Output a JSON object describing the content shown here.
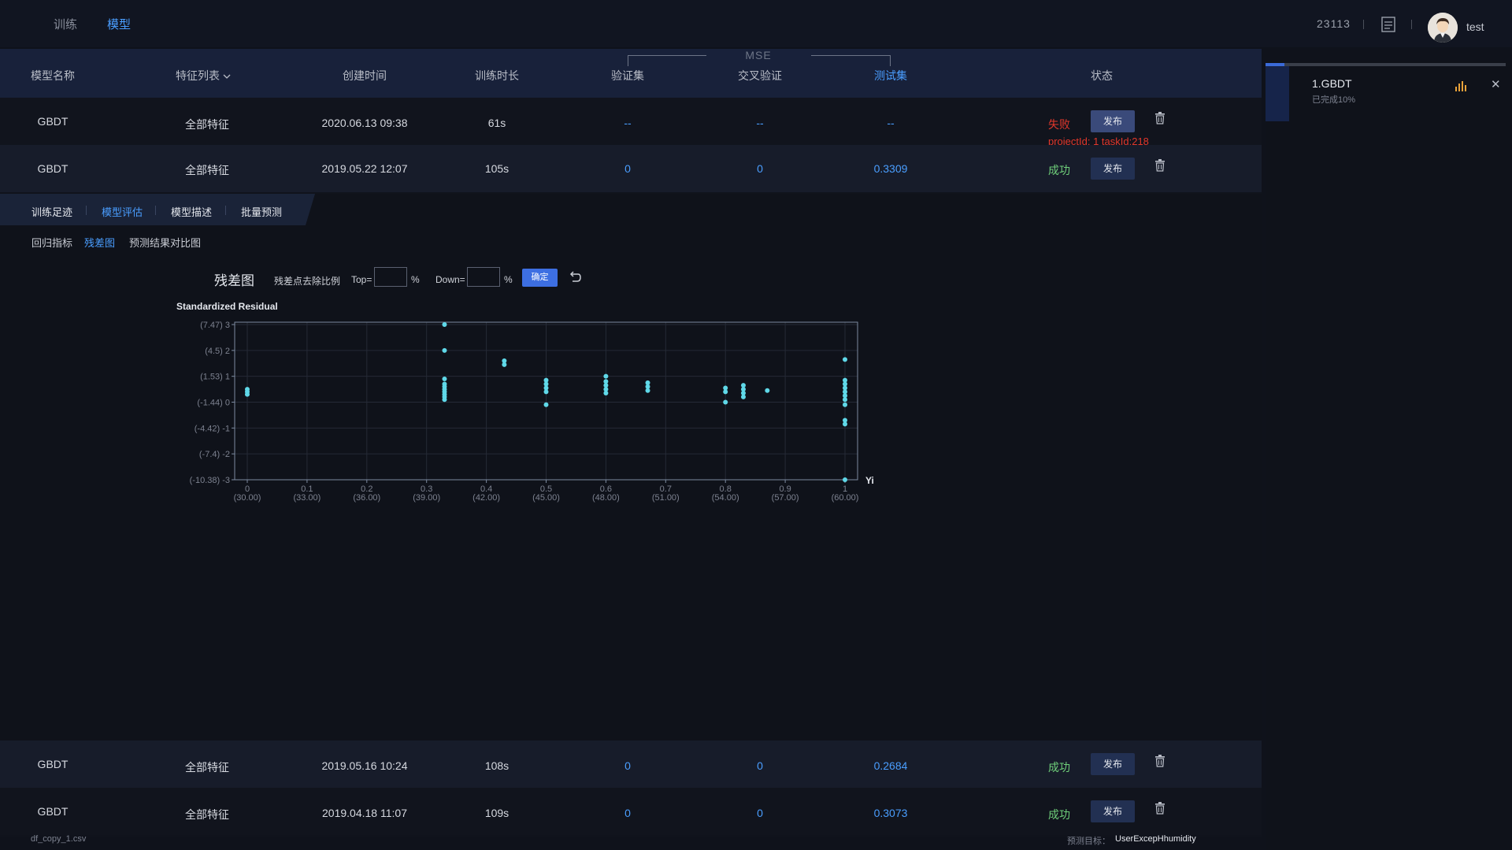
{
  "nav": {
    "tab_train": "训练",
    "tab_model": "模型",
    "user_id": "23113",
    "username": "test"
  },
  "table": {
    "headers": {
      "model_name": "模型名称",
      "features": "特征列表",
      "created": "创建时间",
      "duration": "训练时长",
      "mse_group": "MSE",
      "validation": "验证集",
      "cross_validation": "交叉验证",
      "test": "测试集",
      "status": "状态"
    },
    "publish_label": "发布",
    "rows": [
      {
        "name": "GBDT",
        "features": "全部特征",
        "created": "2020.06.13 09:38",
        "duration": "61s",
        "validation": "--",
        "cross_validation": "--",
        "test": "--",
        "status": "失败",
        "error": "projectId: 1 taskId:218"
      },
      {
        "name": "GBDT",
        "features": "全部特征",
        "created": "2019.05.22 12:07",
        "duration": "105s",
        "validation": "0",
        "cross_validation": "0",
        "test": "0.3309",
        "status": "成功"
      },
      {
        "name": "GBDT",
        "features": "全部特征",
        "created": "2019.05.16 10:24",
        "duration": "108s",
        "validation": "0",
        "cross_validation": "0",
        "test": "0.2684",
        "status": "成功"
      },
      {
        "name": "GBDT",
        "features": "全部特征",
        "created": "2019.04.18 11:07",
        "duration": "109s",
        "validation": "0",
        "cross_validation": "0",
        "test": "0.3073",
        "status": "成功"
      }
    ]
  },
  "detail": {
    "tabs": [
      "训练足迹",
      "模型评估",
      "模型描述",
      "批量预测"
    ],
    "subtabs": [
      "回归指标",
      "残差图",
      "预测结果对比图"
    ],
    "controls": {
      "title": "残差图",
      "remove_ratio_label": "残差点去除比例",
      "top_label": "Top=",
      "down_label": "Down=",
      "pct": "%",
      "ok": "确定"
    }
  },
  "chart_data": {
    "type": "scatter",
    "ylabel": "Standardized Residual",
    "xlabel": "Yi",
    "xlim": [
      0,
      1
    ],
    "ylim": [
      -3,
      3
    ],
    "x_ticks": [
      {
        "v": 0,
        "label": "0",
        "sub": "(30.00)"
      },
      {
        "v": 0.1,
        "label": "0.1",
        "sub": "(33.00)"
      },
      {
        "v": 0.2,
        "label": "0.2",
        "sub": "(36.00)"
      },
      {
        "v": 0.3,
        "label": "0.3",
        "sub": "(39.00)"
      },
      {
        "v": 0.4,
        "label": "0.4",
        "sub": "(42.00)"
      },
      {
        "v": 0.5,
        "label": "0.5",
        "sub": "(45.00)"
      },
      {
        "v": 0.6,
        "label": "0.6",
        "sub": "(48.00)"
      },
      {
        "v": 0.7,
        "label": "0.7",
        "sub": "(51.00)"
      },
      {
        "v": 0.8,
        "label": "0.8",
        "sub": "(54.00)"
      },
      {
        "v": 0.9,
        "label": "0.9",
        "sub": "(57.00)"
      },
      {
        "v": 1,
        "label": "1",
        "sub": "(60.00)"
      }
    ],
    "y_ticks": [
      {
        "v": 3,
        "label": "(7.47) 3"
      },
      {
        "v": 2,
        "label": "(4.5) 2"
      },
      {
        "v": 1,
        "label": "(1.53) 1"
      },
      {
        "v": 0,
        "label": "(-1.44) 0"
      },
      {
        "v": -1,
        "label": "(-4.42) -1"
      },
      {
        "v": -2,
        "label": "(-7.4) -2"
      },
      {
        "v": -3,
        "label": "(-10.38) -3"
      }
    ],
    "grid": true,
    "point_color": "#5fd8e8",
    "points": [
      [
        0.0,
        0.5
      ],
      [
        0.0,
        0.4
      ],
      [
        0.0,
        0.3
      ],
      [
        0.33,
        3.0
      ],
      [
        0.33,
        2.0
      ],
      [
        0.33,
        0.9
      ],
      [
        0.33,
        0.7
      ],
      [
        0.33,
        0.6
      ],
      [
        0.33,
        0.5
      ],
      [
        0.33,
        0.4
      ],
      [
        0.33,
        0.3
      ],
      [
        0.33,
        0.2
      ],
      [
        0.33,
        0.1
      ],
      [
        0.43,
        1.6
      ],
      [
        0.43,
        1.45
      ],
      [
        0.5,
        0.85
      ],
      [
        0.5,
        0.7
      ],
      [
        0.5,
        0.55
      ],
      [
        0.5,
        0.4
      ],
      [
        0.5,
        -0.1
      ],
      [
        0.6,
        1.0
      ],
      [
        0.6,
        0.8
      ],
      [
        0.6,
        0.65
      ],
      [
        0.6,
        0.5
      ],
      [
        0.6,
        0.35
      ],
      [
        0.67,
        0.75
      ],
      [
        0.67,
        0.6
      ],
      [
        0.67,
        0.45
      ],
      [
        0.8,
        0.55
      ],
      [
        0.8,
        0.4
      ],
      [
        0.8,
        0.0
      ],
      [
        0.83,
        0.65
      ],
      [
        0.83,
        0.5
      ],
      [
        0.83,
        0.35
      ],
      [
        0.83,
        0.2
      ],
      [
        0.87,
        0.45
      ],
      [
        1.0,
        1.65
      ],
      [
        1.0,
        0.85
      ],
      [
        1.0,
        0.7
      ],
      [
        1.0,
        0.55
      ],
      [
        1.0,
        0.4
      ],
      [
        1.0,
        0.25
      ],
      [
        1.0,
        0.1
      ],
      [
        1.0,
        -0.1
      ],
      [
        1.0,
        -0.7
      ],
      [
        1.0,
        -0.85
      ],
      [
        1.0,
        -3.0
      ]
    ]
  },
  "footer": {
    "file": "df_copy_1.csv",
    "target_label": "预测目标：",
    "target_value": "UserExcepHhumidity"
  },
  "task": {
    "name": "1.GBDT",
    "progress_text": "已完成10%",
    "progress": 0.1
  },
  "colors": {
    "accent": "#4a9eff",
    "fail": "#e2372b",
    "success": "#6fcf7a"
  }
}
